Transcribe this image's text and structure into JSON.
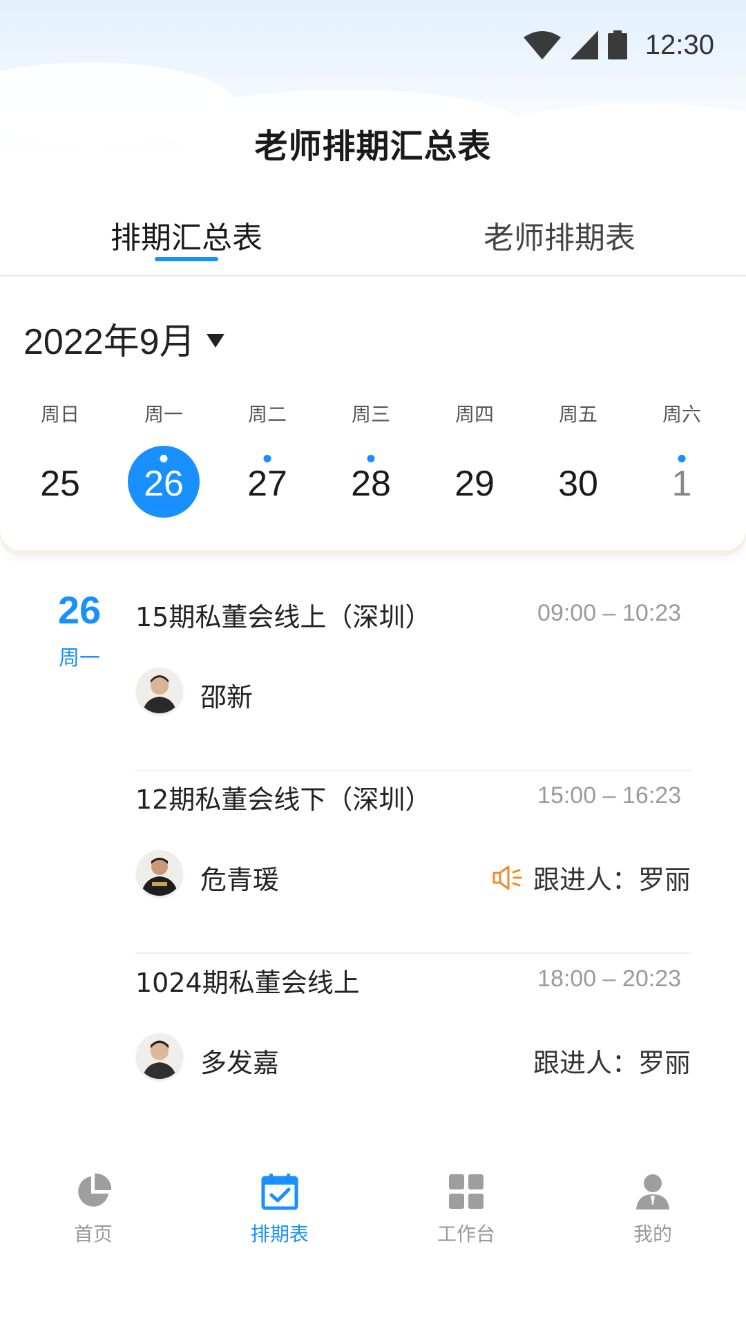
{
  "status": {
    "time": "12:30"
  },
  "page": {
    "title": "老师排期汇总表"
  },
  "tabs": [
    {
      "label": "排期汇总表",
      "active": true
    },
    {
      "label": "老师排期表",
      "active": false
    }
  ],
  "calendar": {
    "month": "2022年9月",
    "week_days": [
      "周日",
      "周一",
      "周二",
      "周三",
      "周四",
      "周五",
      "周六"
    ],
    "dates": [
      {
        "num": "25",
        "has_event": false,
        "selected": false,
        "next_month": false
      },
      {
        "num": "26",
        "has_event": true,
        "selected": true,
        "next_month": false
      },
      {
        "num": "27",
        "has_event": true,
        "selected": false,
        "next_month": false
      },
      {
        "num": "28",
        "has_event": true,
        "selected": false,
        "next_month": false
      },
      {
        "num": "29",
        "has_event": false,
        "selected": false,
        "next_month": false
      },
      {
        "num": "30",
        "has_event": false,
        "selected": false,
        "next_month": false
      },
      {
        "num": "1",
        "has_event": true,
        "selected": false,
        "next_month": true
      }
    ]
  },
  "schedule": {
    "day_num": "26",
    "day_week": "周一",
    "events": [
      {
        "title": "15期私董会线上（深圳）",
        "time": "09:00 – 10:23",
        "teacher": "邵新",
        "follow_label": "",
        "follow_person": "",
        "follow_icon": false
      },
      {
        "title": "12期私董会线下（深圳）",
        "time": "15:00 – 16:23",
        "teacher": "危青瑗",
        "follow_label": "跟进人：",
        "follow_person": "罗丽",
        "follow_icon": true
      },
      {
        "title": "1024期私董会线上",
        "time": "18:00 – 20:23",
        "teacher": "多发嘉",
        "follow_label": "跟进人：",
        "follow_person": "罗丽",
        "follow_icon": false
      }
    ]
  },
  "nav": [
    {
      "label": "首页",
      "icon": "pie-chart-icon",
      "active": false
    },
    {
      "label": "排期表",
      "icon": "calendar-check-icon",
      "active": true
    },
    {
      "label": "工作台",
      "icon": "grid-icon",
      "active": false
    },
    {
      "label": "我的",
      "icon": "user-icon",
      "active": false
    }
  ],
  "colors": {
    "accent": "#1890ff",
    "follow_icon": "#f08a24"
  }
}
